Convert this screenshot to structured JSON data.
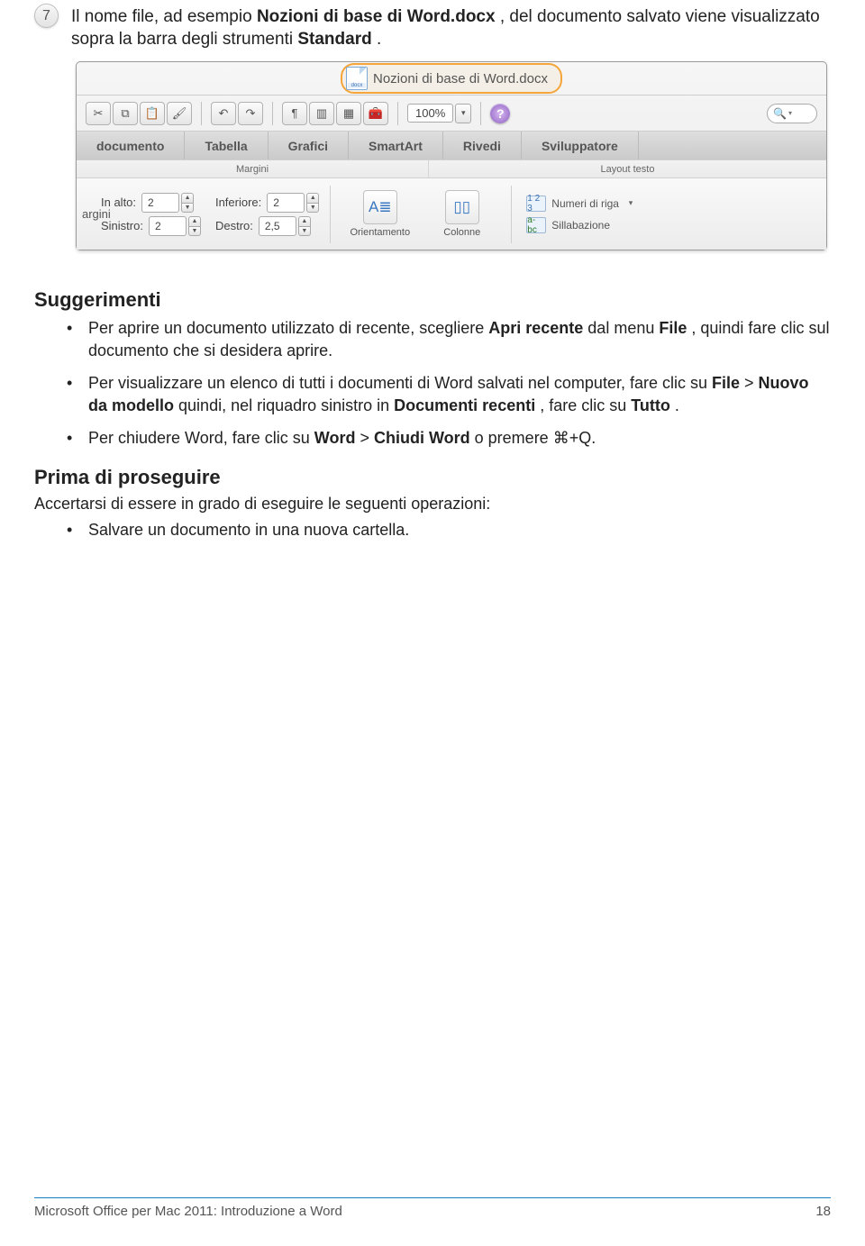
{
  "step": {
    "number": "7",
    "pre": "Il nome file, ad esempio ",
    "bold1": "Nozioni di base di Word.docx",
    "mid": ", del documento salvato viene visualizzato sopra la barra degli strumenti ",
    "bold2": "Standard",
    "post": "."
  },
  "ribbon": {
    "title": "Nozioni di base di Word.docx",
    "zoom": "100%",
    "tabs": [
      "documento",
      "Tabella",
      "Grafici",
      "SmartArt",
      "Rivedi",
      "Sviluppatore"
    ],
    "sublabels": {
      "left": "Margini",
      "right": "Layout testo"
    },
    "left_tab": "argini",
    "fields": {
      "top_label": "In alto:",
      "top_value": "2",
      "bottom_label": "Inferiore:",
      "bottom_value": "2",
      "left_label": "Sinistro:",
      "left_value": "2",
      "right_label": "Destro:",
      "right_value": "2,5"
    },
    "big": {
      "orient": "Orientamento",
      "cols": "Colonne"
    },
    "opts": {
      "righe": "Numeri di riga",
      "sill": "Sillabazione"
    }
  },
  "tips": {
    "heading": "Suggerimenti",
    "items": [
      {
        "pre": "Per aprire un documento utilizzato di recente, scegliere ",
        "b1": "Apri recente",
        "mid": " dal menu ",
        "b2": "File",
        "post": ", quindi fare clic sul documento che si desidera aprire."
      },
      {
        "pre": "Per visualizzare un elenco di tutti i documenti di Word salvati nel computer, fare clic su ",
        "b1": "File",
        "mid": " > ",
        "b2": "Nuovo da modello",
        "mid2": " quindi, nel riquadro sinistro in ",
        "b3": "Documenti recenti",
        "mid3": ", fare clic su ",
        "b4": "Tutto",
        "post": "."
      },
      {
        "pre": "Per chiudere Word, fare clic su ",
        "b1": "Word",
        "mid": " > ",
        "b2": "Chiudi Word",
        "mid2": " o premere ⌘+Q.",
        "post": ""
      }
    ]
  },
  "prima": {
    "heading": "Prima di proseguire",
    "sub": "Accertarsi di essere in grado di eseguire le seguenti operazioni:",
    "item": "Salvare un documento in una nuova cartella."
  },
  "footer": {
    "left": "Microsoft Office per Mac 2011: Introduzione a Word",
    "right": "18"
  }
}
